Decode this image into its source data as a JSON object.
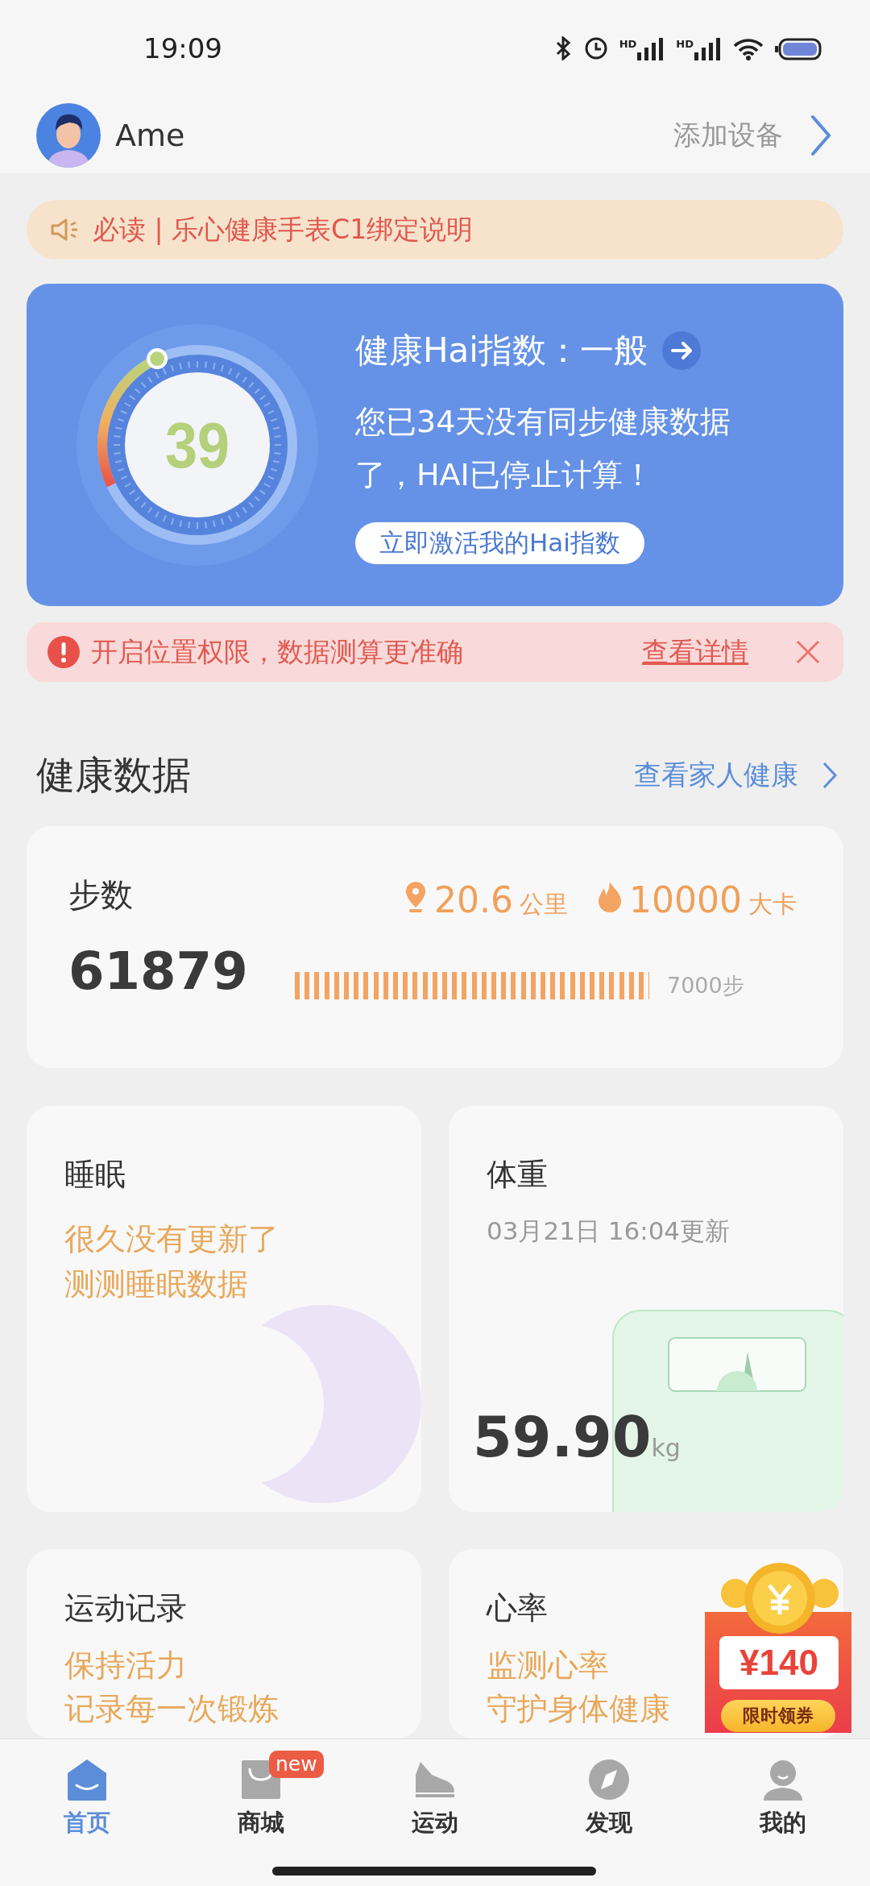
{
  "status_bar": {
    "time": "19:09",
    "signal_labels": [
      "HD",
      "HD"
    ]
  },
  "header": {
    "user_name": "Ame",
    "add_device": "添加设备"
  },
  "notice": {
    "text": "必读 | 乐心健康手表C1绑定说明"
  },
  "hai_card": {
    "title": "健康Hai指数：一般",
    "score": "39",
    "message": "您已34天没有同步健康数据了，HAI已停止计算！",
    "button": "立即激活我的Hai指数"
  },
  "alert": {
    "text": "开启位置权限，数据测算更准确",
    "link": "查看详情"
  },
  "section": {
    "title": "健康数据",
    "link": "查看家人健康"
  },
  "steps": {
    "label": "步数",
    "value": "61879",
    "distance": "20.6",
    "distance_unit": "公里",
    "calories": "10000",
    "calories_unit": "大卡",
    "goal": "7000步",
    "level": 1
  },
  "cards": [
    {
      "kind": "sleep",
      "title": "睡眠",
      "lines": [
        "很久没有更新了",
        "测测睡眠数据"
      ]
    },
    {
      "kind": "weight",
      "title": "体重",
      "updated": "03月21日 16:04更新",
      "value": "59.90",
      "unit": "kg"
    },
    {
      "kind": "exercise",
      "title": "运动记录",
      "lines": [
        "保持活力",
        "记录每一次锻炼"
      ]
    },
    {
      "kind": "heart",
      "title": "心率",
      "lines": [
        "监测心率",
        "守护身体健康"
      ]
    }
  ],
  "coupon": {
    "amount": "¥140",
    "label": "限时领券"
  },
  "tabs": [
    {
      "label": "首页",
      "selected": true
    },
    {
      "label": "商城",
      "selected": false,
      "badge": "new"
    },
    {
      "label": "运动",
      "selected": false
    },
    {
      "label": "发现",
      "selected": false
    },
    {
      "label": "我的",
      "selected": false
    }
  ]
}
